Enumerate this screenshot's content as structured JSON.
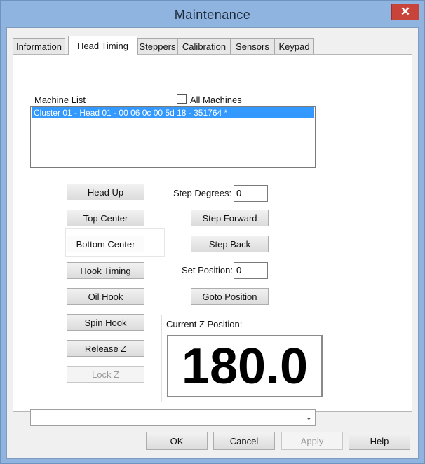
{
  "window": {
    "title": "Maintenance",
    "close_label": "✕"
  },
  "tabs": [
    "Information",
    "Head Timing",
    "Steppers",
    "Calibration",
    "Sensors",
    "Keypad"
  ],
  "active_tab": "Head Timing",
  "machine_list": {
    "label": "Machine List",
    "all_machines_label": "All Machines",
    "all_machines_checked": false,
    "items": [
      "Cluster 01 - Head 01 - 00 06 0c 00 5d 18 - 351764 *"
    ],
    "selected_index": 0
  },
  "left_buttons": {
    "head_up": "Head Up",
    "top_center": "Top Center",
    "bottom_center": "Bottom Center",
    "hook_timing": "Hook Timing",
    "oil_hook": "Oil Hook",
    "spin_hook": "Spin Hook",
    "release_z": "Release Z",
    "lock_z": "Lock Z"
  },
  "right_controls": {
    "step_degrees_label": "Step Degrees:",
    "step_degrees_value": "0",
    "step_forward": "Step Forward",
    "step_back": "Step Back",
    "set_position_label": "Set Position:",
    "set_position_value": "0",
    "goto_position": "Goto Position"
  },
  "z_position": {
    "label": "Current Z Position:",
    "value": "180.0"
  },
  "dropdown": {
    "value": ""
  },
  "footer": {
    "ok": "OK",
    "cancel": "Cancel",
    "apply": "Apply",
    "help": "Help"
  }
}
